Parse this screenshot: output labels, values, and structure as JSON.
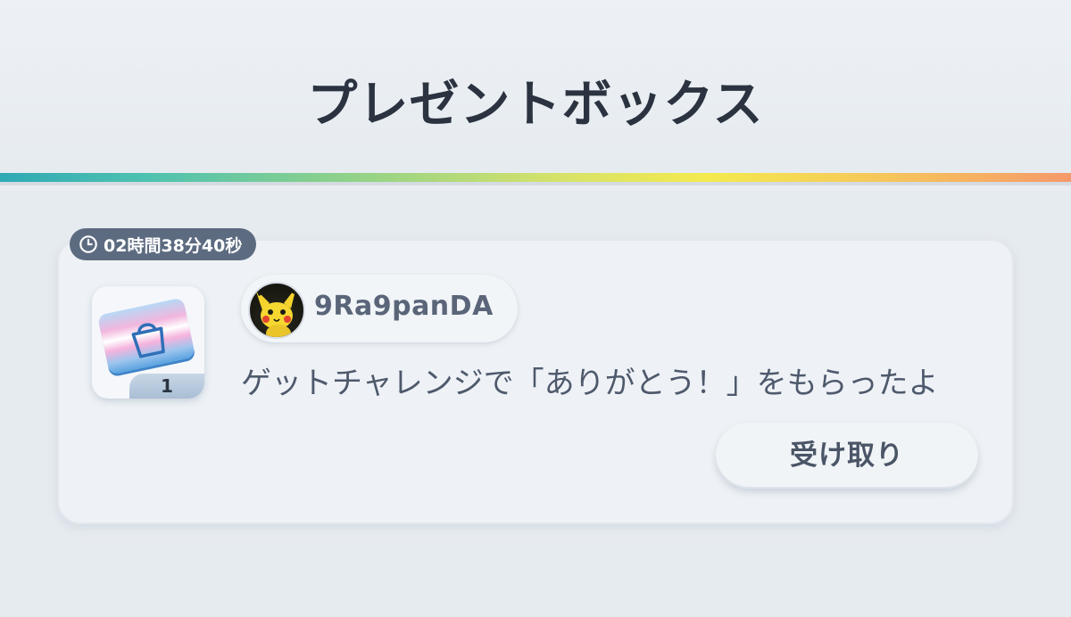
{
  "header": {
    "title": "プレゼントボックス"
  },
  "present": {
    "timer": "02時間38分40秒",
    "item_quantity": "1",
    "sender_name": "9Ra9panDA",
    "message": "ゲットチャレンジで「ありがとう！」をもらったよ",
    "receive_label": "受け取り"
  },
  "colors": {
    "title_text": "#2b3340",
    "timer_bg": "#5c6b80",
    "accent_line_start": "#2fa9b4",
    "accent_line_mid": "#f4ea4e",
    "accent_line_end": "#f59a6a"
  },
  "icons": {
    "timer": "clock-icon",
    "item": "shopping-bag-ticket-icon",
    "avatar": "pikachu-avatar"
  }
}
